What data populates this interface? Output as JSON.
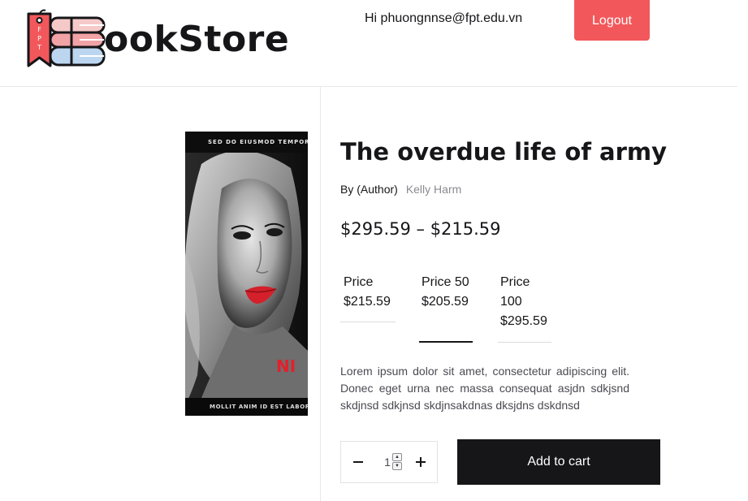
{
  "header": {
    "logo_tag": "FPT",
    "logo_text": "ookStore",
    "greeting": "Hi phuongnnse@fpt.edu.vn",
    "logout_label": "Logout"
  },
  "product": {
    "cover": {
      "top_text": "SED DO EIUSMOD TEMPOR INCIDIDUNT",
      "bottom_text": "MOLLIT ANIM ID EST LABORUM"
    },
    "title": "The overdue life of army",
    "author_prefix": "By (Author)",
    "author_name": "Kelly Harm",
    "price_range": "$295.59 – $215.59",
    "variants": [
      {
        "label": "Price",
        "price": "$215.59",
        "selected": false
      },
      {
        "label": "Price 50",
        "price": "$205.59",
        "selected": true
      },
      {
        "label": "Price 100",
        "price": "$295.59",
        "selected": false
      }
    ],
    "description": "Lorem ipsum dolor sit amet, consectetur adipiscing elit. Donec eget urna nec massa consequat asjdn sdkjsnd skdjnsd sdkjnsd skdjnsakdnas dksjdns dskdnsd",
    "quantity": "1",
    "add_to_cart_label": "Add to cart"
  },
  "colors": {
    "accent": "#f2585b",
    "dark": "#161619",
    "muted": "#8a8a91"
  }
}
